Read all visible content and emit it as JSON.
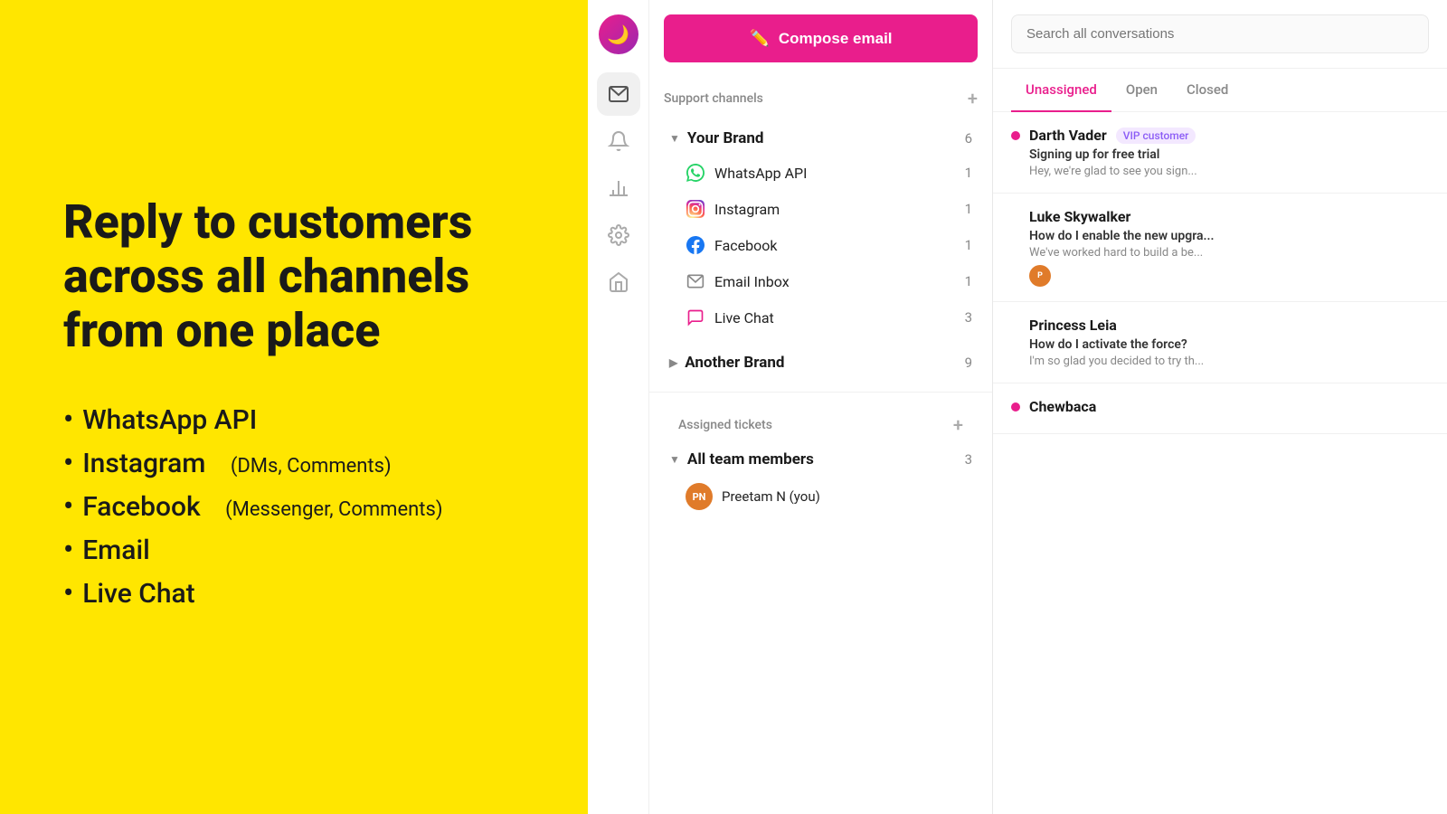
{
  "left": {
    "title": "Reply to customers\nacross all channels\nfrom one place",
    "features": [
      {
        "main": "WhatsApp API",
        "sub": ""
      },
      {
        "main": "Instagram",
        "sub": "(DMs, Comments)"
      },
      {
        "main": "Facebook",
        "sub": "(Messenger, Comments)"
      },
      {
        "main": "Email",
        "sub": ""
      },
      {
        "main": "Live Chat",
        "sub": ""
      }
    ]
  },
  "app": {
    "logo": "🌙",
    "compose_button": "Compose email",
    "support_channels_label": "Support channels",
    "brands": [
      {
        "name": "Your Brand",
        "count": "6",
        "expanded": true,
        "channels": [
          {
            "name": "WhatsApp API",
            "count": "1",
            "icon": "whatsapp"
          },
          {
            "name": "Instagram",
            "count": "1",
            "icon": "instagram"
          },
          {
            "name": "Facebook",
            "count": "1",
            "icon": "facebook"
          },
          {
            "name": "Email Inbox",
            "count": "1",
            "icon": "email"
          },
          {
            "name": "Live Chat",
            "count": "3",
            "icon": "livechat"
          }
        ]
      },
      {
        "name": "Another Brand",
        "count": "9",
        "expanded": false,
        "channels": []
      }
    ],
    "assigned_tickets_label": "Assigned tickets",
    "teams": [
      {
        "name": "All team members",
        "count": "3",
        "expanded": true
      }
    ],
    "agents": [
      {
        "initials": "PN",
        "name": "Preetam N (you)"
      }
    ]
  },
  "conversations": {
    "search_placeholder": "Search all conversations",
    "tabs": [
      {
        "label": "Unassigned",
        "active": true
      },
      {
        "label": "Open",
        "active": false
      },
      {
        "label": "Closed",
        "active": false
      }
    ],
    "items": [
      {
        "name": "Darth Vader",
        "badge": "VIP customer",
        "subject": "Signing up for free trial",
        "preview": "Hey, we're glad to see you sign...",
        "online": true,
        "has_agents": false
      },
      {
        "name": "Luke Skywalker",
        "badge": "",
        "subject": "How do I enable the new upgra...",
        "preview": "We've worked hard to build a be...",
        "online": false,
        "has_agents": true
      },
      {
        "name": "Princess Leia",
        "badge": "",
        "subject": "How do I activate the force?",
        "preview": "I'm so glad you decided to try th...",
        "online": false,
        "has_agents": false
      },
      {
        "name": "Chewbaca",
        "badge": "",
        "subject": "",
        "preview": "",
        "online": true,
        "has_agents": false
      }
    ]
  }
}
